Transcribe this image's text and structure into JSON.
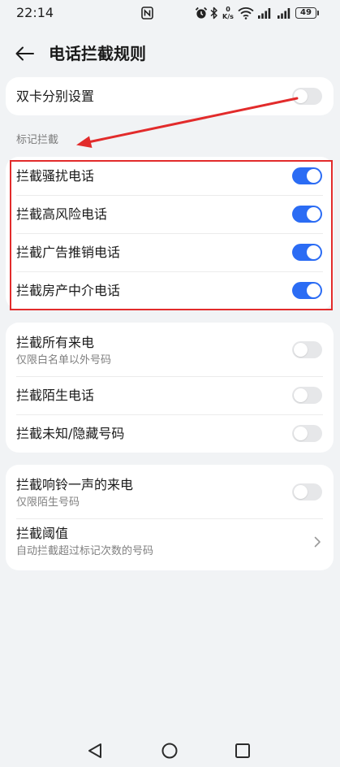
{
  "status_bar": {
    "time": "22:14",
    "net_speed_value": "0",
    "net_speed_unit": "K/s",
    "battery_level": "49"
  },
  "header": {
    "title": "电话拦截规则"
  },
  "dual_sim": {
    "label": "双卡分别设置",
    "enabled": false
  },
  "marked_section": {
    "title": "标记拦截",
    "items": [
      {
        "label": "拦截骚扰电话",
        "enabled": true
      },
      {
        "label": "拦截高风险电话",
        "enabled": true
      },
      {
        "label": "拦截广告推销电话",
        "enabled": true
      },
      {
        "label": "拦截房产中介电话",
        "enabled": true
      }
    ]
  },
  "general_section": {
    "items": [
      {
        "label": "拦截所有来电",
        "subtitle": "仅限白名单以外号码",
        "enabled": false
      },
      {
        "label": "拦截陌生电话",
        "enabled": false
      },
      {
        "label": "拦截未知/隐藏号码",
        "enabled": false
      }
    ]
  },
  "other_section": {
    "items": [
      {
        "label": "拦截响铃一声的来电",
        "subtitle": "仅限陌生号码",
        "enabled": false
      },
      {
        "label": "拦截阈值",
        "subtitle": "自动拦截超过标记次数的号码"
      }
    ]
  },
  "icons": {
    "status": [
      "nfc-icon",
      "alarm-icon",
      "bluetooth-icon",
      "wifi-icon",
      "signal-icon",
      "signal-icon",
      "battery-icon"
    ],
    "header_back": "back-arrow-icon",
    "threshold_chevron": "chevron-right-icon",
    "nav": [
      "nav-back-icon",
      "nav-home-icon",
      "nav-recents-icon"
    ]
  },
  "colors": {
    "accent": "#2b6cf4",
    "annotation": "#e22b2b",
    "page_background": "#f1f3f5",
    "card_background": "#ffffff",
    "text_primary": "#1a1a1a",
    "text_secondary": "#808080",
    "toggle_off": "#e6e7e9"
  }
}
